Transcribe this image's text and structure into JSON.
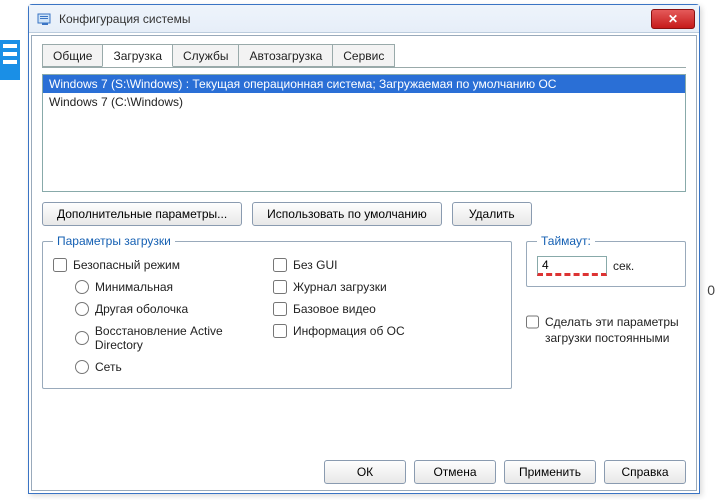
{
  "backdrop": {
    "right_char": "0"
  },
  "window": {
    "title": "Конфигурация системы",
    "tabs": [
      {
        "label": "Общие"
      },
      {
        "label": "Загрузка"
      },
      {
        "label": "Службы"
      },
      {
        "label": "Автозагрузка"
      },
      {
        "label": "Сервис"
      }
    ],
    "active_tab": 1,
    "boot_list": [
      {
        "text": "Windows 7 (S:\\Windows) : Текущая операционная система; Загружаемая по умолчанию ОС",
        "selected": true
      },
      {
        "text": "Windows 7 (C:\\Windows)",
        "selected": false
      }
    ],
    "buttons": {
      "advanced": "Дополнительные параметры...",
      "set_default": "Использовать по умолчанию",
      "delete": "Удалить"
    },
    "boot_params": {
      "legend": "Параметры загрузки",
      "safe_mode": "Безопасный режим",
      "minimal": "Минимальная",
      "alt_shell": "Другая оболочка",
      "ad_repair": "Восстановление Active Directory",
      "network": "Сеть",
      "no_gui": "Без GUI",
      "boot_log": "Журнал загрузки",
      "base_video": "Базовое видео",
      "os_info": "Информация  об ОС"
    },
    "timeout": {
      "legend": "Таймаут:",
      "value": "4",
      "unit": "сек."
    },
    "persist_label": "Сделать эти параметры загрузки постоянными",
    "footer": {
      "ok": "ОК",
      "cancel": "Отмена",
      "apply": "Применить",
      "help": "Справка"
    }
  }
}
